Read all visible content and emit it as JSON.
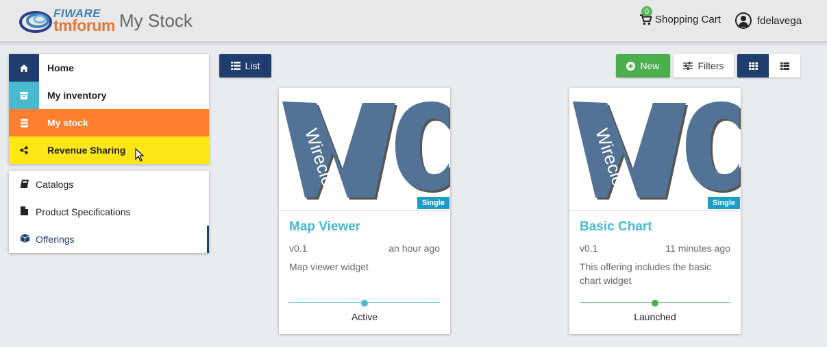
{
  "header": {
    "logo_top": "FIWARE",
    "logo_bottom": "tmforum",
    "title": "My Stock",
    "cart_count": "0",
    "cart_label": "Shopping Cart",
    "username": "fdelavega"
  },
  "nav": {
    "main": [
      {
        "label": "Home",
        "icon": "home-icon"
      },
      {
        "label": "My inventory",
        "icon": "archive-icon"
      },
      {
        "label": "My stock",
        "icon": "database-icon"
      },
      {
        "label": "Revenue Sharing",
        "icon": "share-icon"
      }
    ],
    "sub": [
      {
        "label": "Catalogs",
        "icon": "book-icon"
      },
      {
        "label": "Product Specifications",
        "icon": "file-icon"
      },
      {
        "label": "Offerings",
        "icon": "cube-icon"
      }
    ]
  },
  "toolbar": {
    "list_label": "List",
    "new_label": "New",
    "filters_label": "Filters"
  },
  "cards": [
    {
      "image_text": "Wirecloud",
      "badge": "Single",
      "title": "Map Viewer",
      "version": "v0.1",
      "time": "an hour ago",
      "description": "Map viewer widget",
      "status": "Active"
    },
    {
      "image_text": "Wirecloud",
      "badge": "Single",
      "title": "Basic Chart",
      "version": "v0.1",
      "time": "11 minutes ago",
      "description": "This offering includes the basic chart widget",
      "status": "Launched"
    }
  ],
  "colors": {
    "primary": "#1f3d6e",
    "accent": "#4ab9cf",
    "stock": "#ff7f2e",
    "revenue": "#ffe619",
    "success": "#4cae4c",
    "badge": "#1e9cc8"
  }
}
